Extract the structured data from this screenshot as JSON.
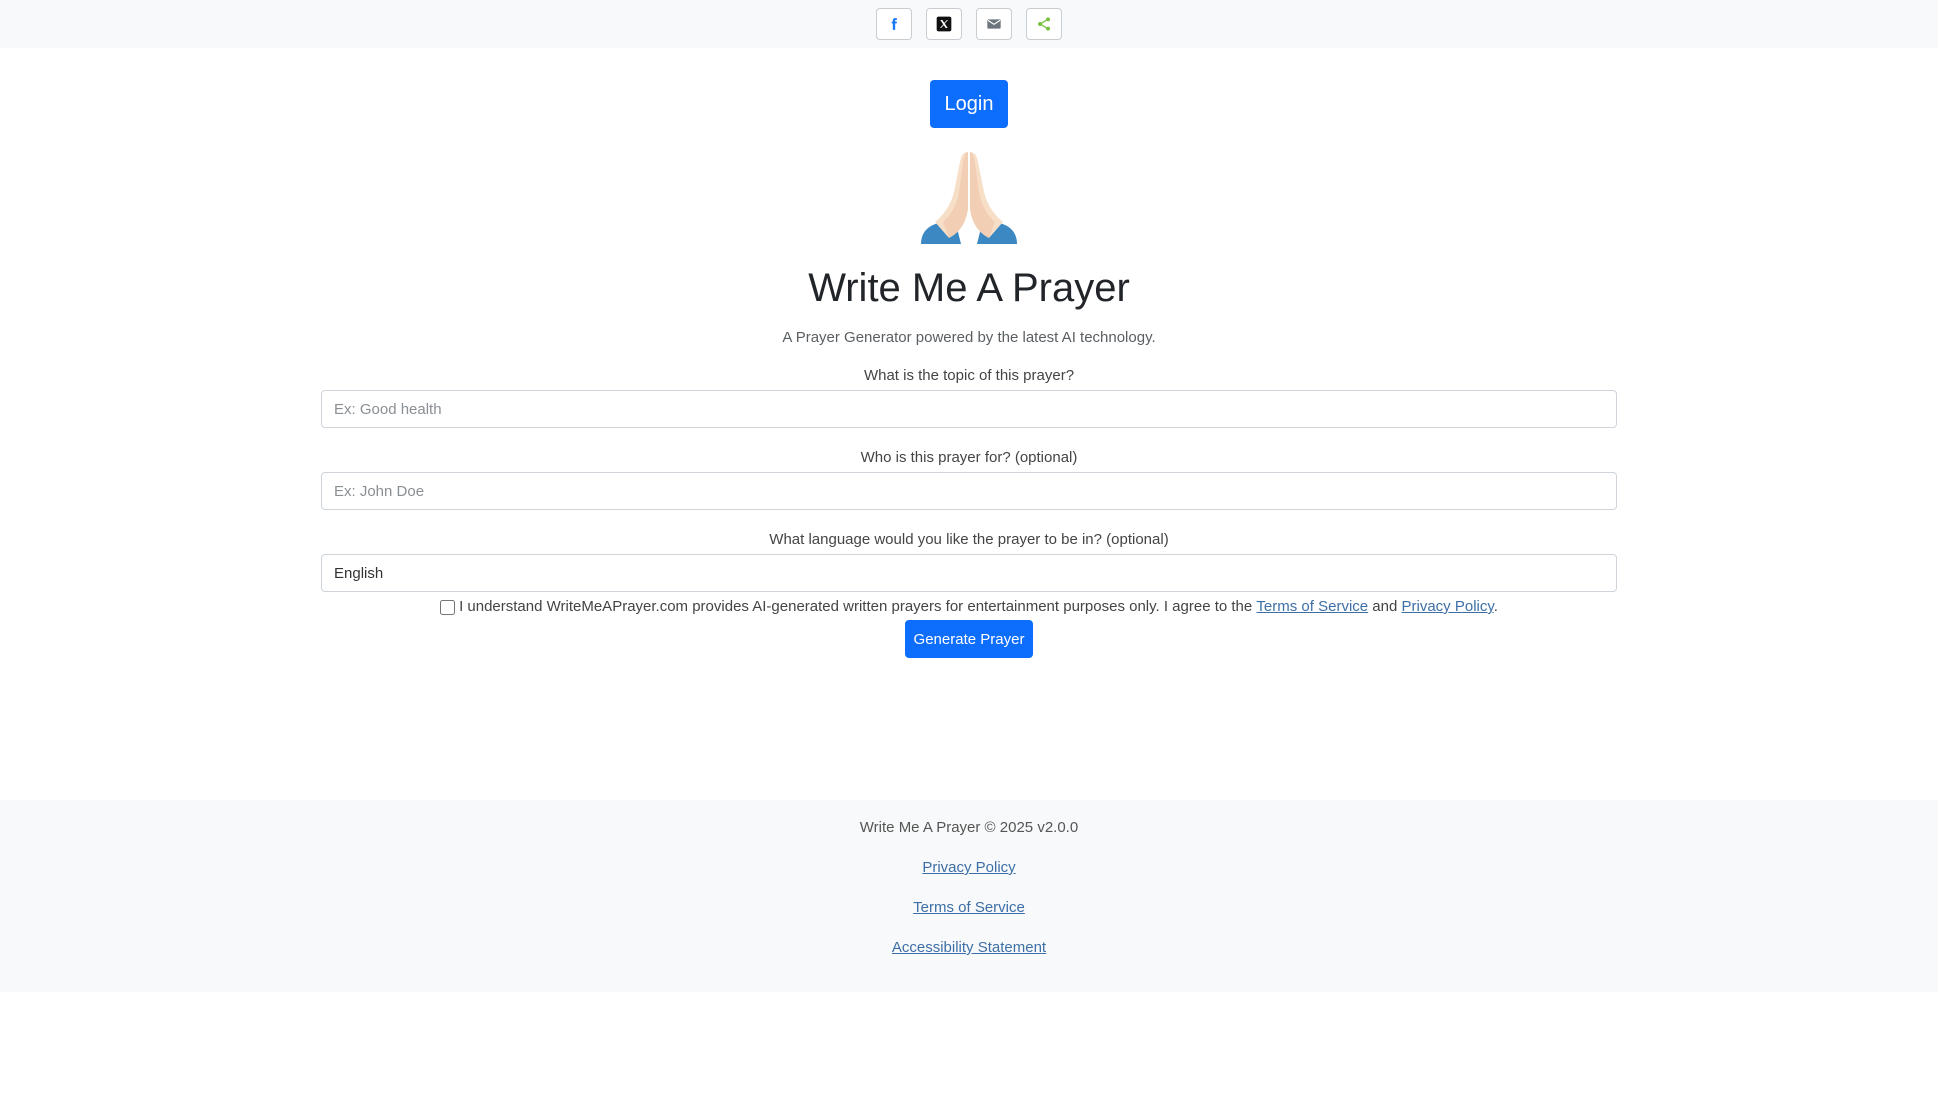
{
  "share_bar": {
    "buttons": [
      {
        "icon": "facebook-icon"
      },
      {
        "icon": "x-twitter-icon"
      },
      {
        "icon": "email-icon"
      },
      {
        "icon": "share-icon"
      }
    ]
  },
  "header": {
    "login_label": "Login",
    "title": "Write Me A Prayer",
    "subtitle": "A Prayer Generator powered by the latest AI technology.",
    "hero_icon": "praying-hands-icon"
  },
  "form": {
    "topic": {
      "label": "What is the topic of this prayer?",
      "placeholder": "Ex: Good health",
      "value": ""
    },
    "recipient": {
      "label": "Who is this prayer for? (optional)",
      "placeholder": "Ex: John Doe",
      "value": ""
    },
    "language": {
      "label": "What language would you like the prayer to be in? (optional)",
      "placeholder": "",
      "value": "English"
    },
    "consent": {
      "text_before": "I understand WriteMeAPrayer.com provides AI-generated written prayers for entertainment purposes only. I agree to the",
      "terms_link": "Terms of Service",
      "conjunction": "and",
      "privacy_link": "Privacy Policy",
      "text_after": ".",
      "checked": false
    },
    "submit_label": "Generate Prayer"
  },
  "footer": {
    "copyright": "Write Me A Prayer © 2025 v2.0.0",
    "links": [
      "Privacy Policy",
      "Terms of Service",
      "Accessibility Statement"
    ]
  },
  "colors": {
    "primary": "#0d6efd",
    "link": "#3d6fa6",
    "facebook": "#1877f2",
    "share": "#7ac143",
    "muted_bg": "#f8f9fa"
  }
}
